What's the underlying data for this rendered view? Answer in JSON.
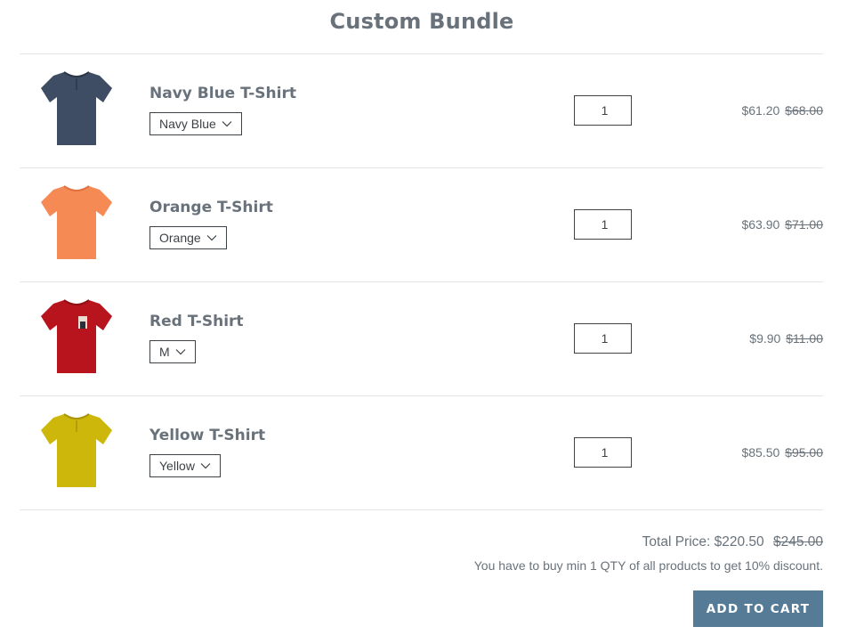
{
  "title": "Custom Bundle",
  "products": [
    {
      "name": "Navy Blue T-Shirt",
      "variant": "Navy Blue",
      "qty": "1",
      "price": "$61.20",
      "compare_price": "$68.00",
      "color": "#3e4d63",
      "icon": "navy-tshirt-icon"
    },
    {
      "name": "Orange T-Shirt",
      "variant": "Orange",
      "qty": "1",
      "price": "$63.90",
      "compare_price": "$71.00",
      "color": "#f58a55",
      "icon": "orange-tshirt-icon"
    },
    {
      "name": "Red T-Shirt",
      "variant": "M",
      "qty": "1",
      "price": "$9.90",
      "compare_price": "$11.00",
      "color": "#b8141d",
      "icon": "red-tshirt-icon"
    },
    {
      "name": "Yellow T-Shirt",
      "variant": "Yellow",
      "qty": "1",
      "price": "$85.50",
      "compare_price": "$95.00",
      "color": "#cdb70a",
      "icon": "yellow-tshirt-icon"
    }
  ],
  "total": {
    "label": "Total Price: $220.50",
    "compare": "$245.00"
  },
  "note": "You have to buy min 1 QTY of all products to get 10% discount.",
  "add_to_cart": "ADD TO CART",
  "colors": {
    "button": "#557b97",
    "text": "#69727b",
    "border": "#3d4246",
    "rule": "#e4e4e4"
  }
}
